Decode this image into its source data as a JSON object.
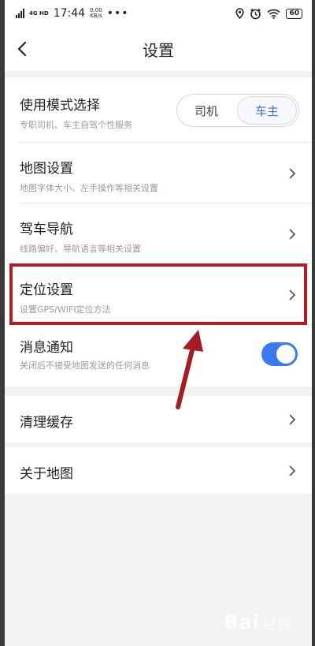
{
  "status_bar": {
    "network": "4G HD",
    "time": "17:44",
    "speed_value": "0.00",
    "speed_unit": "KB/s",
    "dots": "•••",
    "battery": "60"
  },
  "header": {
    "title": "设置"
  },
  "mode": {
    "label": "使用模式选择",
    "desc": "专职司机、车主自驾个性服务",
    "options": [
      "司机",
      "车主"
    ],
    "selected": "车主"
  },
  "items": [
    {
      "label": "地图设置",
      "desc": "地图字体大小、左手操作等相关设置"
    },
    {
      "label": "驾车导航",
      "desc": "线路偏好、导航语言等相关设置"
    },
    {
      "label": "定位设置",
      "desc": "设置GPS/WIFI定位方法"
    }
  ],
  "notify": {
    "label": "消息通知",
    "desc": "关闭后不接受地图发送的任何消息",
    "enabled": true
  },
  "clear_cache": {
    "label": "清理缓存"
  },
  "about": {
    "label": "关于地图"
  },
  "watermark": {
    "brand": "Bai",
    "brand2": "经验"
  },
  "colors": {
    "accent": "#3a7af0",
    "highlight": "#b51c22"
  }
}
